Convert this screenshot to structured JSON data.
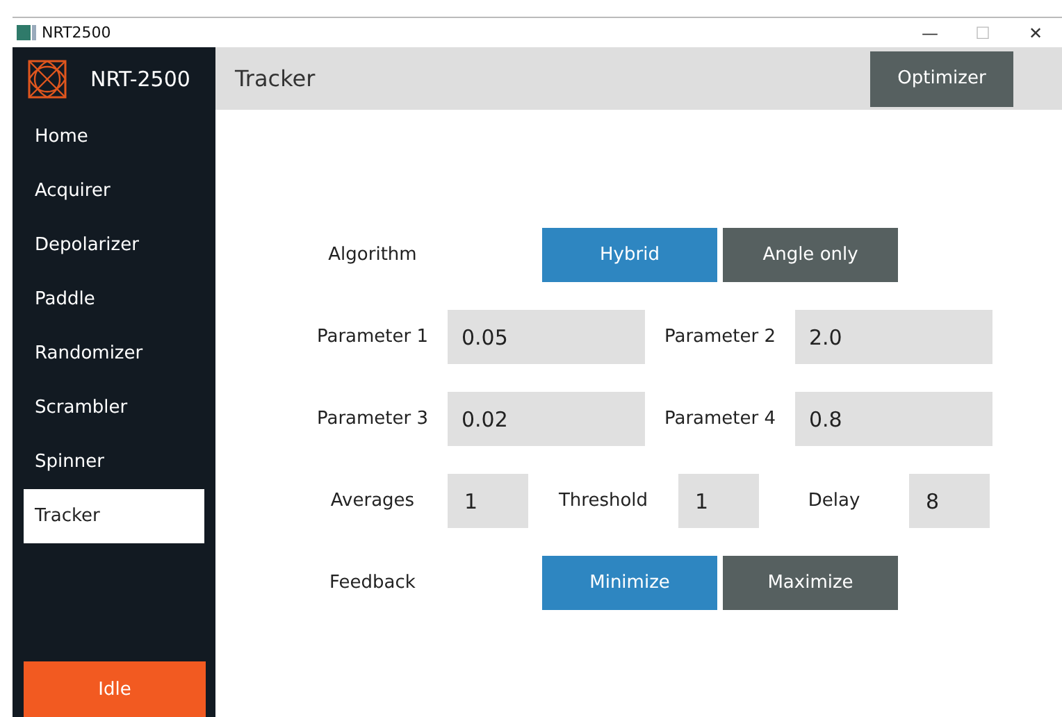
{
  "window": {
    "title": "NRT2500",
    "controls": [
      "—",
      "☐",
      "✕"
    ]
  },
  "sidebar": {
    "brand": "NRT-2500",
    "items": [
      {
        "label": "Home",
        "selected": false
      },
      {
        "label": "Acquirer",
        "selected": false
      },
      {
        "label": "Depolarizer",
        "selected": false
      },
      {
        "label": "Paddle",
        "selected": false
      },
      {
        "label": "Randomizer",
        "selected": false
      },
      {
        "label": "Scrambler",
        "selected": false
      },
      {
        "label": "Spinner",
        "selected": false
      },
      {
        "label": "Tracker",
        "selected": true
      }
    ],
    "status_button": "Idle"
  },
  "header": {
    "title": "Tracker",
    "button": "Optimizer"
  },
  "form": {
    "rows": [
      {
        "kind": "choice",
        "label": "Algorithm",
        "options": [
          {
            "label": "Hybrid",
            "selected": true
          },
          {
            "label": "Angle only",
            "selected": false
          }
        ]
      },
      {
        "kind": "wide",
        "fields": [
          {
            "label": "Parameter 1",
            "value": "0.05"
          },
          {
            "label": "Parameter 2",
            "value": "2.0"
          }
        ]
      },
      {
        "kind": "wide",
        "fields": [
          {
            "label": "Parameter 3",
            "value": "0.02"
          },
          {
            "label": "Parameter 4",
            "value": "0.8"
          }
        ]
      },
      {
        "kind": "narrow",
        "fields": [
          {
            "label": "Averages",
            "value": "1"
          },
          {
            "label": "Threshold",
            "value": "1"
          },
          {
            "label": "Delay",
            "value": "8"
          }
        ]
      },
      {
        "kind": "choice",
        "label": "Feedback",
        "options": [
          {
            "label": "Minimize",
            "selected": true
          },
          {
            "label": "Maximize",
            "selected": false
          }
        ]
      }
    ]
  }
}
